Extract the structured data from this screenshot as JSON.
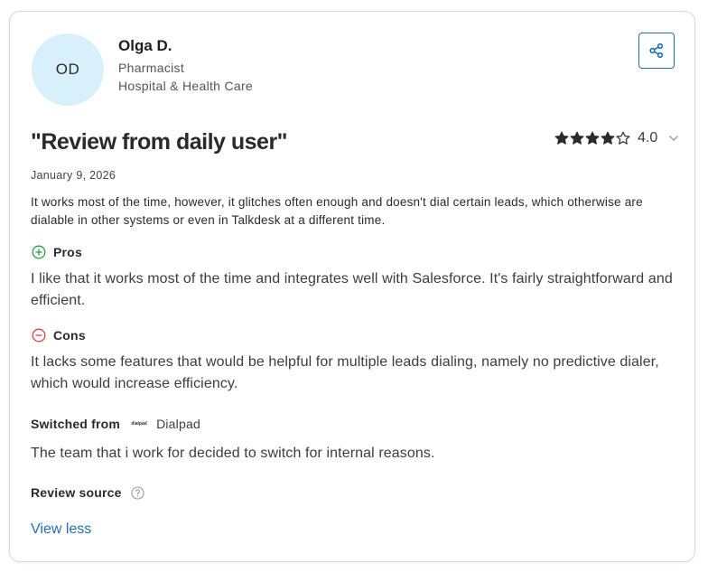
{
  "reviewer": {
    "initials": "OD",
    "name": "Olga D.",
    "title": "Pharmacist",
    "industry": "Hospital & Health Care"
  },
  "share": {
    "icon": "share-icon",
    "color": "#1f6fb8"
  },
  "review": {
    "title": "\"Review from daily user\"",
    "rating": 4,
    "rating_max": 5,
    "rating_label": "4.0",
    "date": "January 9, 2026",
    "summary": "It works most of the time, however, it glitches often enough and doesn't dial certain leads, which otherwise are dialable in other systems or even in Talkdesk at a different time."
  },
  "pros": {
    "label": "Pros",
    "icon": "plus-circle-icon",
    "color": "#2e9b3e",
    "text": "I like that it works most of the time and integrates well with Salesforce. It's fairly straightforward and efficient."
  },
  "cons": {
    "label": "Cons",
    "icon": "minus-circle-icon",
    "color": "#d9453d",
    "text": "It lacks some features that would be helpful for multiple leads dialing, namely no predictive dialer, which would increase efficiency."
  },
  "switched": {
    "label": "Switched from",
    "logo_text": "dialpad",
    "product": "Dialpad",
    "reason": "The team that i work for decided to switch for internal reasons."
  },
  "source": {
    "label": "Review source",
    "icon": "question-circle-icon"
  },
  "actions": {
    "view_less": "View less",
    "link_color": "#1f6fb8"
  }
}
